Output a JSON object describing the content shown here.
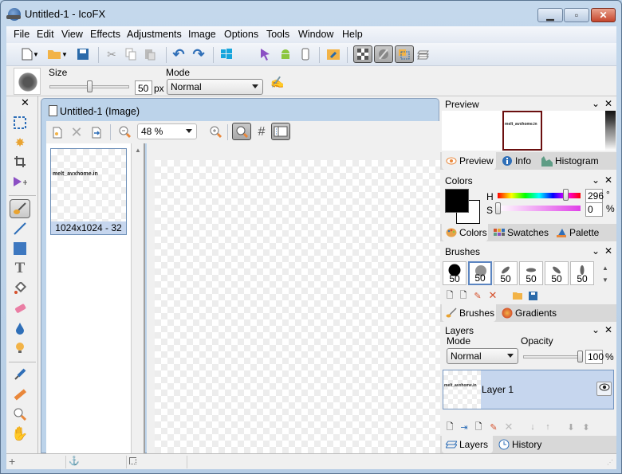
{
  "window": {
    "title": "Untitled-1 - IcoFX",
    "controls": {
      "minimize": "▁",
      "maximize": "▫",
      "close": "✕"
    }
  },
  "menu": [
    "File",
    "Edit",
    "View",
    "Effects",
    "Adjustments",
    "Image",
    "Options",
    "Tools",
    "Window",
    "Help"
  ],
  "toolbar": {
    "icons": [
      "new-file",
      "open-folder",
      "save",
      "cut",
      "copy",
      "paste",
      "undo",
      "redo",
      "windows",
      "apple",
      "cursor",
      "android",
      "mobile",
      "tools-folder",
      "checkerboard",
      "mask",
      "selection",
      "layers"
    ]
  },
  "options_bar": {
    "size_label": "Size",
    "size_value": "50",
    "size_unit": "px",
    "size_slider_fraction": 0.5,
    "mode_label": "Mode",
    "mode_value": "Normal"
  },
  "tools": [
    "rectangle-select",
    "magic-wand",
    "crop",
    "move",
    "brush",
    "line",
    "rectangle",
    "text",
    "fill",
    "eraser",
    "blur-drop",
    "light-bulb",
    "eyedropper",
    "ruler",
    "zoom",
    "hand"
  ],
  "document": {
    "title": "Untitled-1 (Image)",
    "zoom_value": "48 %",
    "thumbnail_caption": "1024x1024 - 32",
    "watermark": "melt_avxhome.in"
  },
  "panels": {
    "preview": {
      "title": "Preview",
      "tabs": [
        "Preview",
        "Info",
        "Histogram"
      ],
      "active_tab": "Preview",
      "watermark": "melt_avxhome.in"
    },
    "colors": {
      "title": "Colors",
      "h_label": "H",
      "h_value": "296",
      "h_unit": "°",
      "s_label": "S",
      "s_value": "0",
      "s_unit": "%",
      "primary_color": "#000000",
      "tabs": [
        "Colors",
        "Swatches",
        "Palette"
      ],
      "active_tab": "Colors"
    },
    "brushes": {
      "title": "Brushes",
      "items": [
        "50",
        "50",
        "50",
        "50",
        "50",
        "50"
      ],
      "selected_index": 1,
      "tabs": [
        "Brushes",
        "Gradients"
      ],
      "active_tab": "Brushes"
    },
    "layers": {
      "title": "Layers",
      "mode_label": "Mode",
      "mode_value": "Normal",
      "opacity_label": "Opacity",
      "opacity_value": "100",
      "opacity_unit": "%",
      "layer_name": "Layer 1",
      "watermark": "melt_avxhome.in",
      "tabs": [
        "Layers",
        "History"
      ],
      "active_tab": "Layers"
    }
  },
  "colors": {
    "accent": "#5b85c1",
    "selection": "#c6d6ee",
    "preview_frame": "#6b0f0f"
  }
}
